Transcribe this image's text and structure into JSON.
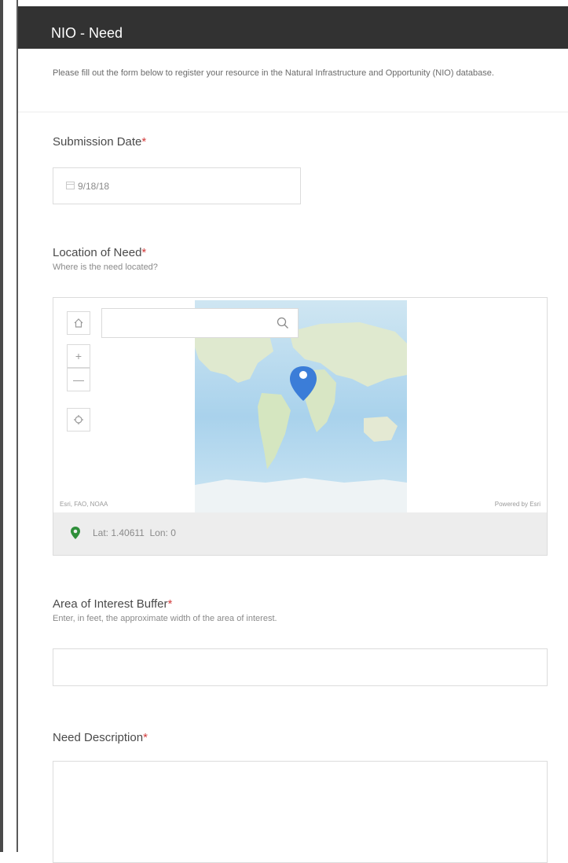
{
  "header": {
    "title": "NIO - Need"
  },
  "intro": "Please fill out the form below to register your resource in the Natural Infrastructure and Opportunity (NIO) database.",
  "submission_date": {
    "label": "Submission Date",
    "required_mark": "*",
    "value": "9/18/18"
  },
  "location": {
    "label": "Location of Need",
    "required_mark": "*",
    "hint": "Where is the need located?",
    "map": {
      "attribution": "Esri, FAO, NOAA",
      "powered_by": "Powered by Esri"
    },
    "coordinates": "Lat: 1.40611  Lon: 0"
  },
  "buffer": {
    "label": "Area of Interest Buffer",
    "required_mark": "*",
    "hint": "Enter, in feet, the approximate width of the area of interest.",
    "value": ""
  },
  "description": {
    "label": "Need Description",
    "required_mark": "*",
    "value": ""
  },
  "colors": {
    "header_bg": "#323232",
    "required": "#d23b3b",
    "pin": "#3b7dd8",
    "location_pin": "#2f8f3a"
  }
}
